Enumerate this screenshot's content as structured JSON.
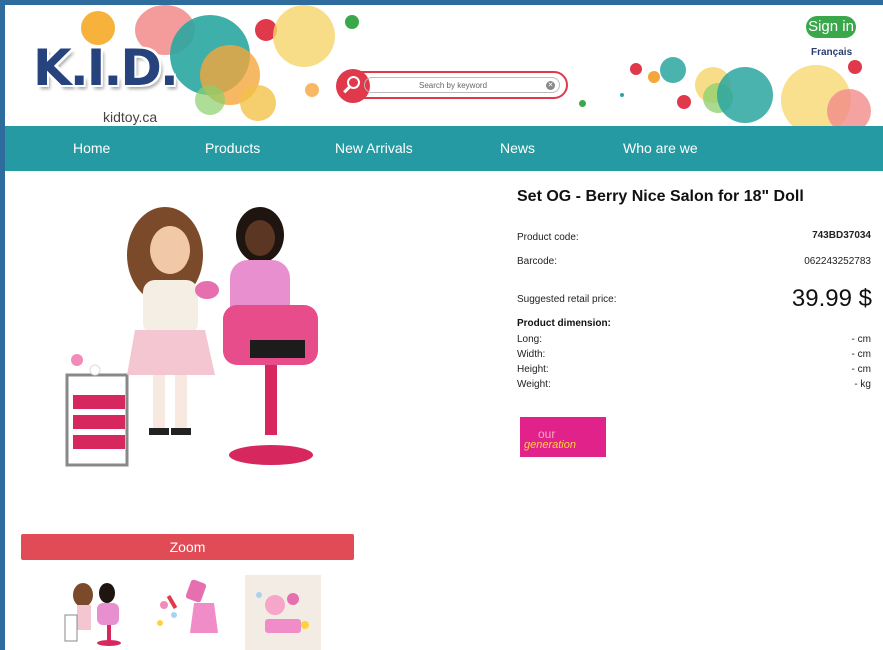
{
  "header": {
    "logo_text": "K.I.D.",
    "logo_subtitle": "kidtoy.ca",
    "search_placeholder": "Search by keyword",
    "sign_in": "Sign in",
    "language": "Français"
  },
  "nav": {
    "items": [
      "Home",
      "Products",
      "New Arrivals",
      "News",
      "Who are we"
    ]
  },
  "product": {
    "title": "Set OG - Berry Nice Salon for 18\" Doll",
    "product_code_label": "Product code:",
    "product_code": "743BD37034",
    "barcode_label": "Barcode:",
    "barcode": "062243252783",
    "price_label": "Suggested retail price:",
    "price": "39.99 $",
    "dimension_title": "Product dimension:",
    "dimensions": [
      {
        "label": "Long:",
        "value": "- cm"
      },
      {
        "label": "Width:",
        "value": "- cm"
      },
      {
        "label": "Height:",
        "value": "- cm"
      },
      {
        "label": "Weight:",
        "value": "- kg"
      }
    ],
    "brand": "Our generation",
    "zoom_label": "Zoom"
  },
  "colors": {
    "nav_bg": "#269aa3",
    "accent_red": "#e14b55",
    "signin_green": "#3aa84a",
    "logo_blue": "#27437e"
  }
}
